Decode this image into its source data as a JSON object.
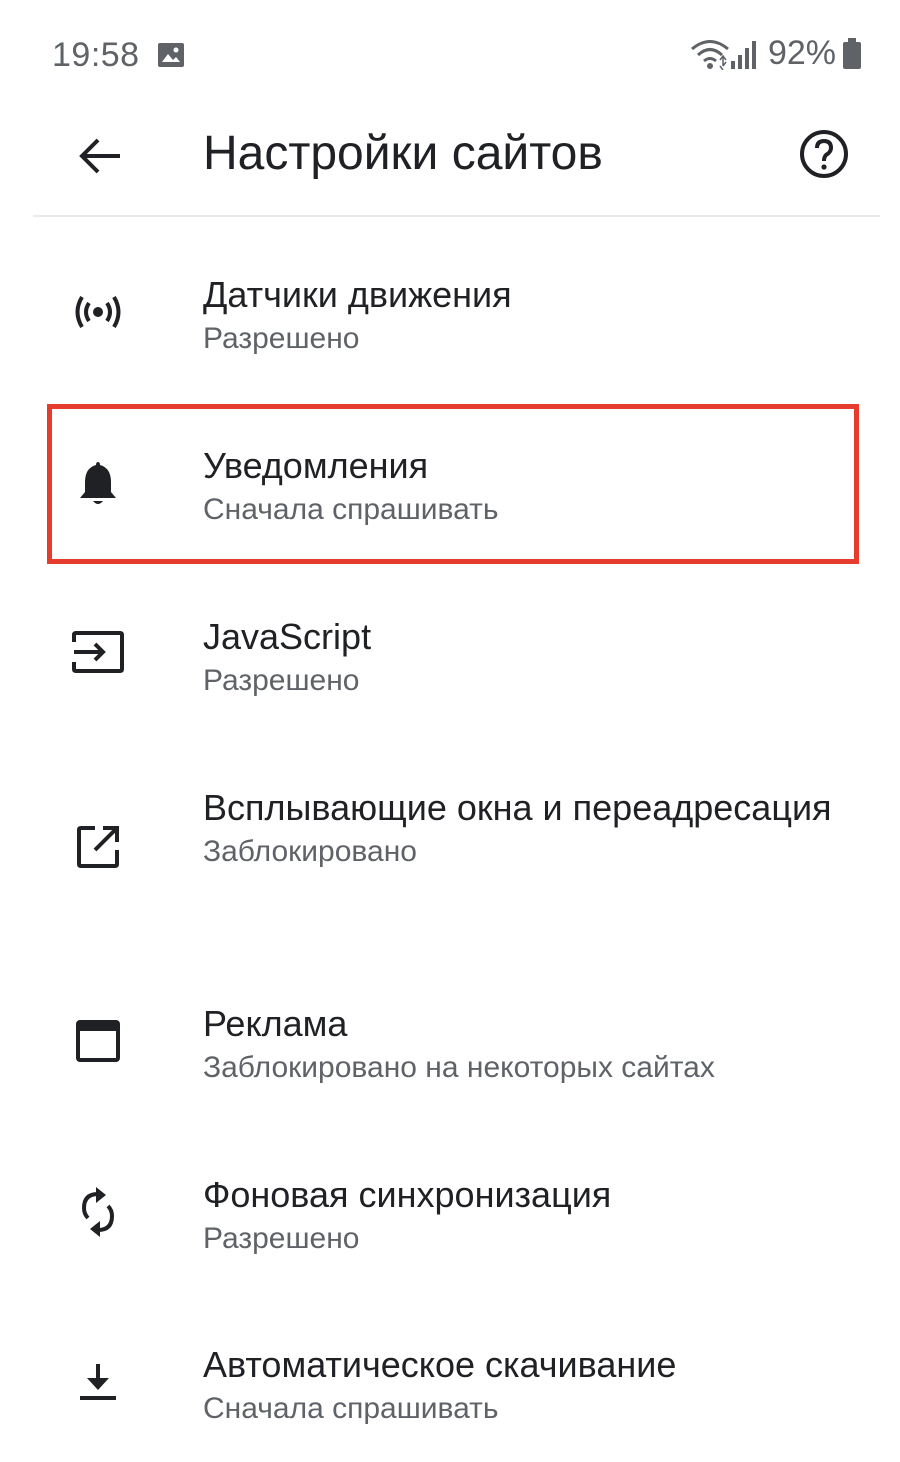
{
  "status_bar": {
    "time": "19:58",
    "battery": "92%",
    "icons": [
      "gallery-icon",
      "wifi-icon",
      "signal-icon",
      "battery-icon"
    ]
  },
  "app_bar": {
    "title": "Настройки сайтов",
    "back_icon": "arrow-left-icon",
    "help_icon": "help-circle-icon"
  },
  "settings": {
    "items": [
      {
        "title": "Датчики движения",
        "subtitle": "Разрешено",
        "icon": "motion-sensors-icon"
      },
      {
        "title": "Уведомления",
        "subtitle": "Сначала спрашивать",
        "icon": "bell-icon",
        "highlighted": true
      },
      {
        "title": "JavaScript",
        "subtitle": "Разрешено",
        "icon": "javascript-icon"
      },
      {
        "title": "Всплывающие окна и переадресация",
        "subtitle": "Заблокировано",
        "icon": "popup-icon"
      },
      {
        "title": "Реклама",
        "subtitle": "Заблокировано на некоторых сайтах",
        "icon": "ads-icon"
      },
      {
        "title": "Фоновая синхронизация",
        "subtitle": "Разрешено",
        "icon": "sync-icon"
      },
      {
        "title": "Автоматическое скачивание",
        "subtitle": "Сначала спрашивать",
        "icon": "download-icon"
      }
    ]
  },
  "colors": {
    "highlight_border": "#e53c2e",
    "primary_text": "#202124",
    "secondary_text": "#5f6368"
  }
}
